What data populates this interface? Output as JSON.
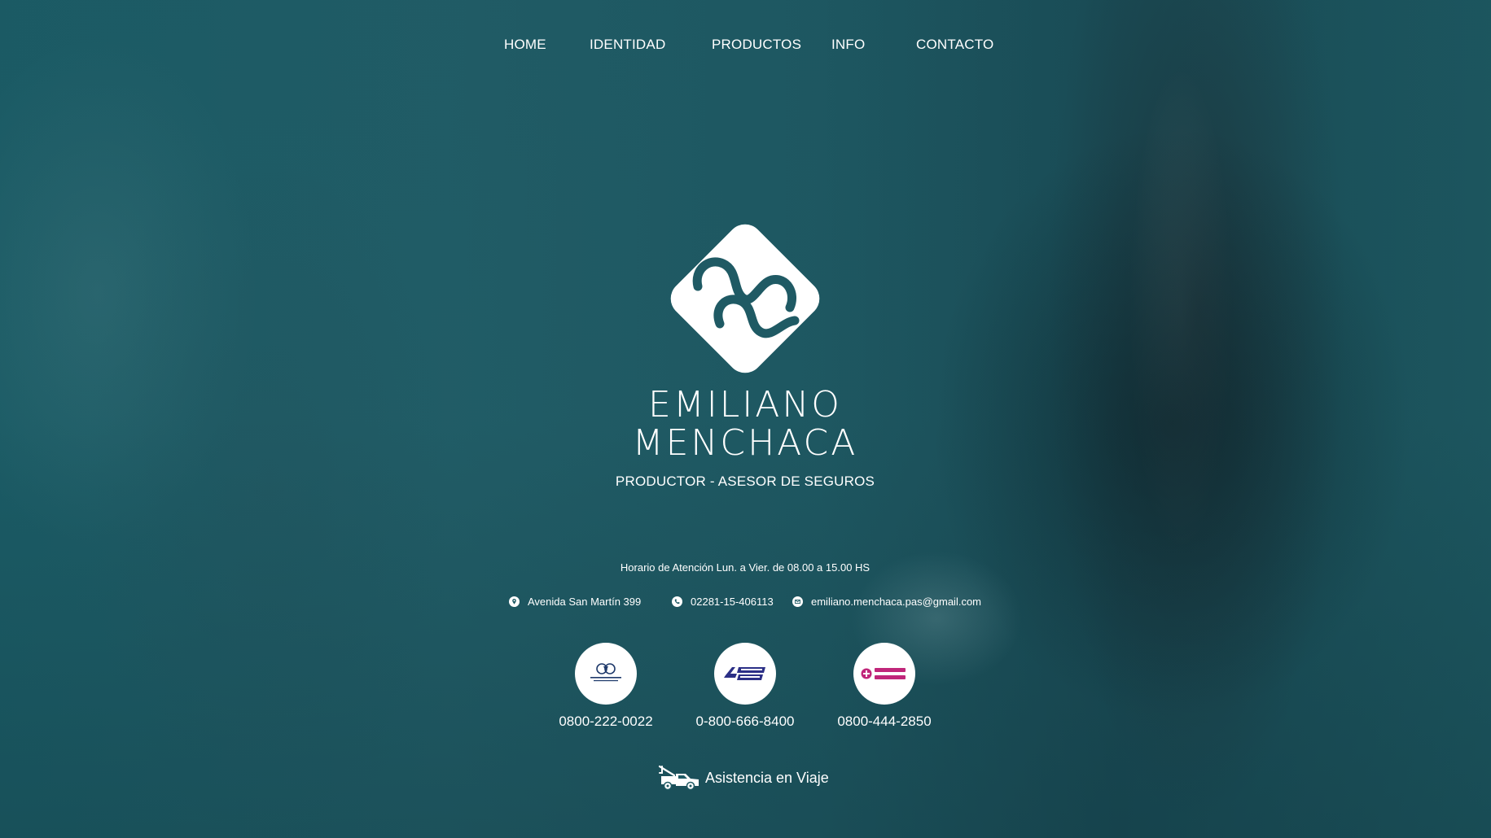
{
  "nav": {
    "items": [
      {
        "label": "HOME"
      },
      {
        "label": "IDENTIDAD"
      },
      {
        "label": "PRODUCTOS"
      },
      {
        "label": "INFO"
      },
      {
        "label": "CONTACTO"
      }
    ]
  },
  "hero": {
    "name_first": "EMILIANO",
    "name_last": "MENCHACA",
    "tagline": "PRODUCTOR - ASESOR DE SEGUROS"
  },
  "info": {
    "hours": "Horario de Atención Lun. a Vier. de 08.00 a 15.00 HS",
    "address": "Avenida San Martín 399",
    "phone": "02281-15-406113",
    "email": "emiliano.menchaca.pas@gmail.com",
    "icons": [
      "location-pin-icon",
      "phone-icon",
      "email-icon"
    ]
  },
  "insurers": [
    {
      "logo": "federacion-patronal-logo",
      "phone": "0800-222-0022"
    },
    {
      "logo": "copan-seguros-logo",
      "phone": "0-800-666-8400"
    },
    {
      "logo": "sancor-seguros-logo",
      "phone": "0800-444-2850"
    }
  ],
  "assistance": {
    "label": "Asistencia en Viaje",
    "icon": "tow-truck-icon"
  },
  "colors": {
    "background_teal": "#1f5a64",
    "text": "#ffffff",
    "copan_blue": "#2b2f86",
    "sancor_pink": "#c0267a"
  }
}
